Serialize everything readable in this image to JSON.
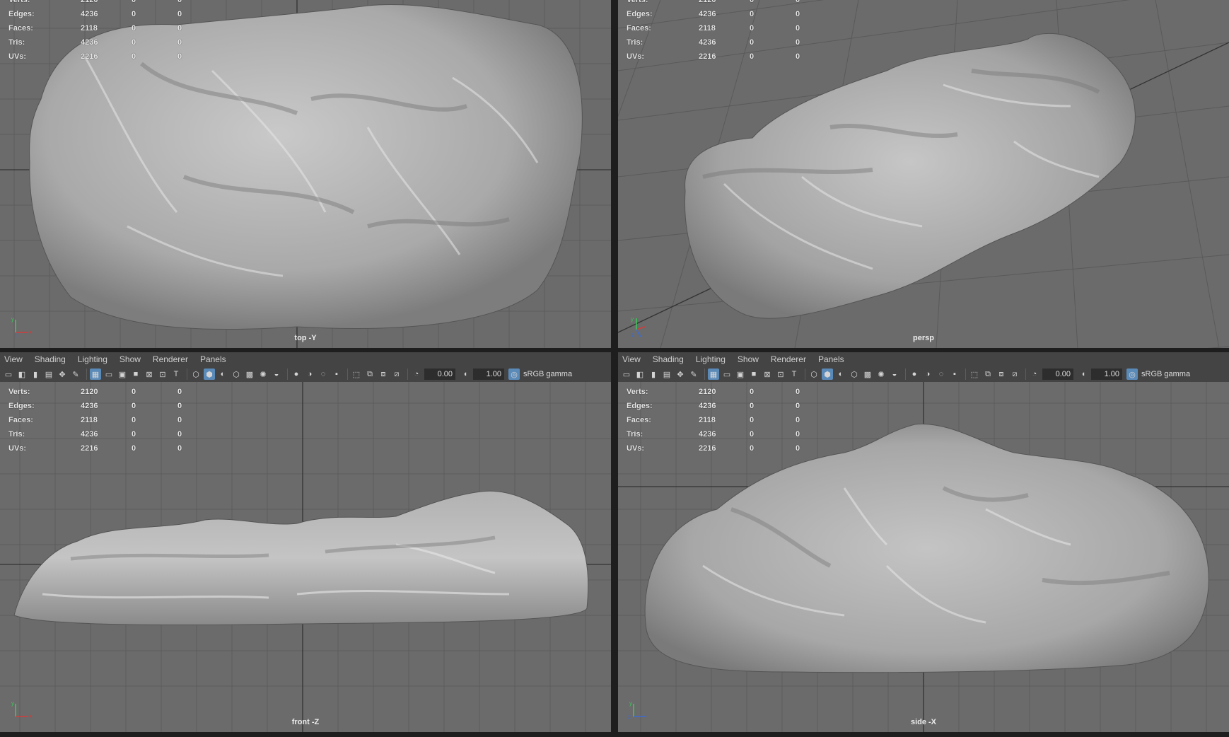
{
  "menus": [
    "View",
    "Shading",
    "Lighting",
    "Show",
    "Renderer",
    "Panels"
  ],
  "toolbar": {
    "exposure": "0.00",
    "gamma_value": "1.00",
    "colorspace": "sRGB gamma"
  },
  "stats_labels": {
    "verts": "Verts:",
    "edges": "Edges:",
    "faces": "Faces:",
    "tris": "Tris:",
    "uvs": "UVs:"
  },
  "stats_values": {
    "verts": [
      "2120",
      "0",
      "0"
    ],
    "edges": [
      "4236",
      "0",
      "0"
    ],
    "faces": [
      "2118",
      "0",
      "0"
    ],
    "tris": [
      "4236",
      "0",
      "0"
    ],
    "uvs": [
      "2216",
      "0",
      "0"
    ]
  },
  "top_partial_verts": "2120",
  "cameras": {
    "top": "top -Y",
    "persp": "persp",
    "front": "front -Z",
    "side": "side -X"
  },
  "axis_labels": {
    "x": "x",
    "y": "y",
    "z": "z"
  },
  "colors": {
    "viewport_bg": "#6b6b6b",
    "grid": "#5a5a5a",
    "grid_axis": "#303030",
    "toolbar_bg": "#444444",
    "active_icon": "#5a8ab8"
  }
}
